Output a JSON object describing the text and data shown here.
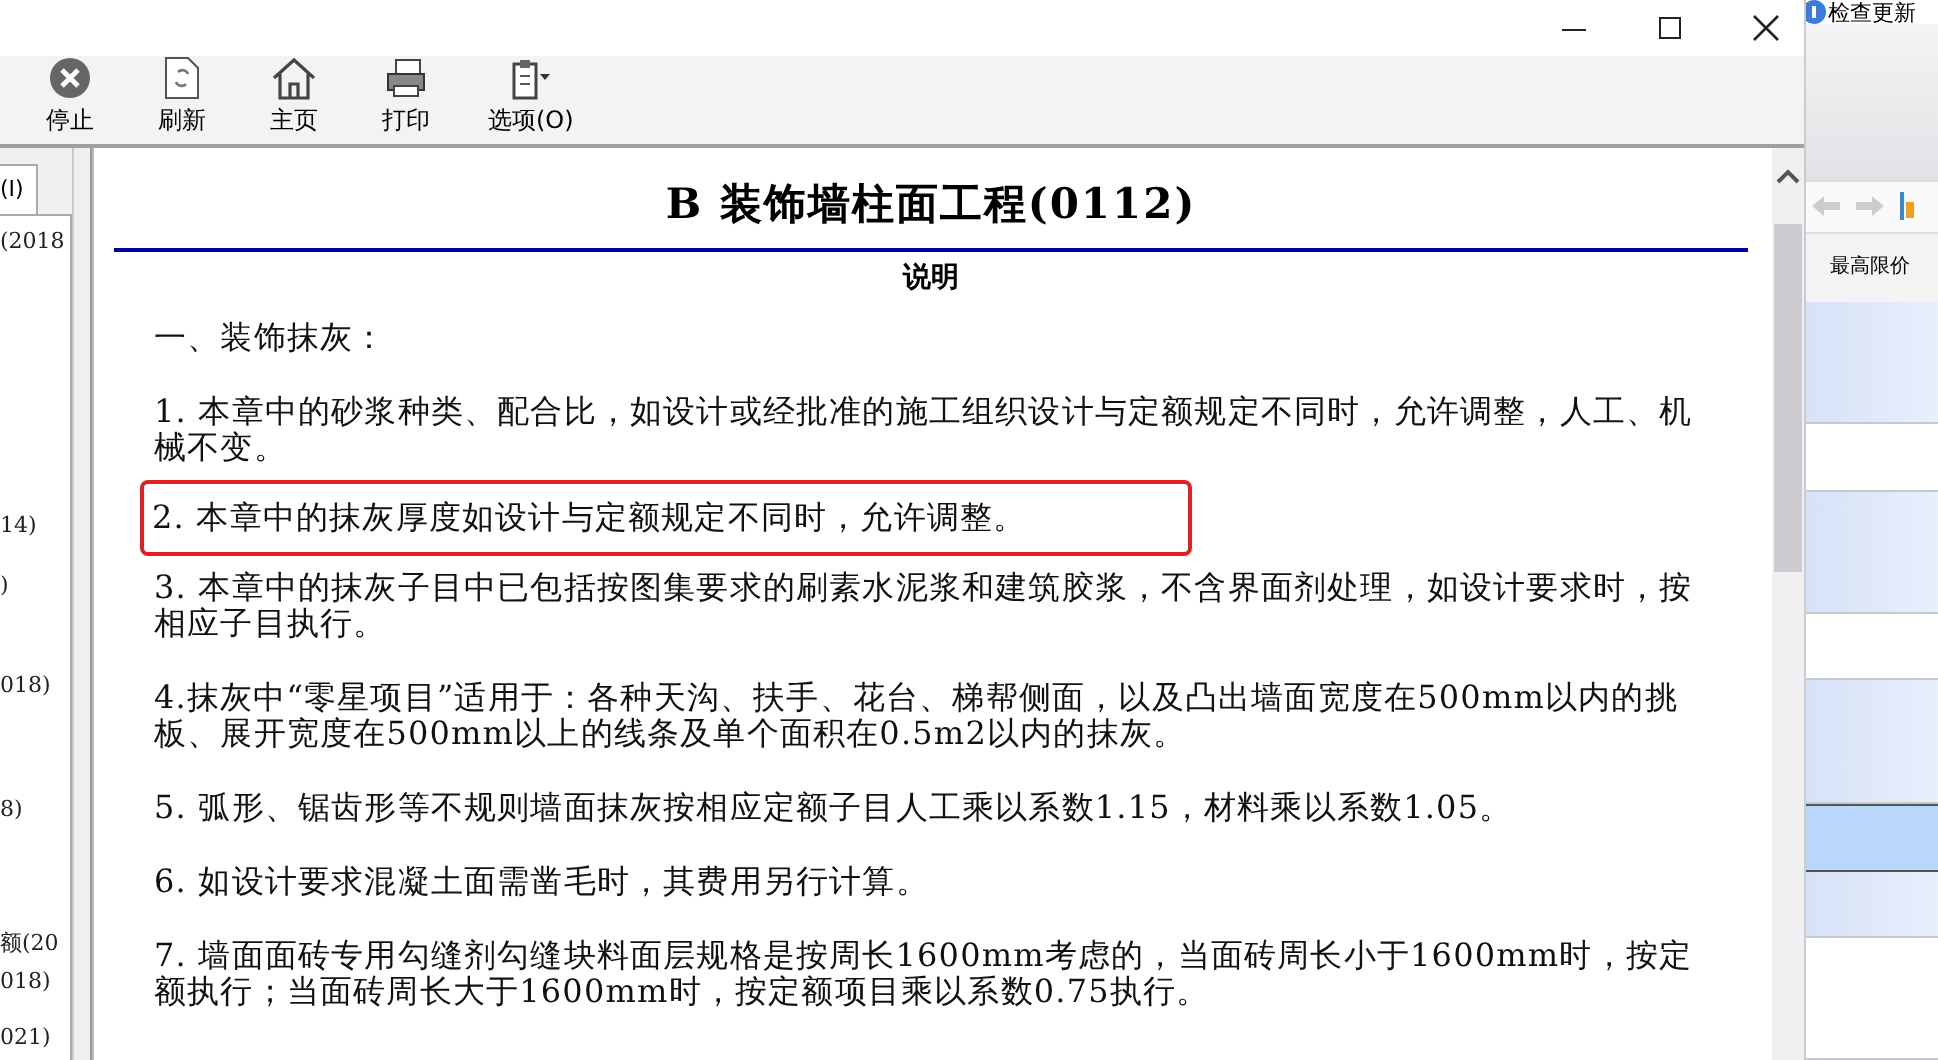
{
  "toolbar": [
    {
      "label": "停止",
      "kind": "stop"
    },
    {
      "label": "刷新",
      "kind": "refresh"
    },
    {
      "label": "主页",
      "kind": "home"
    },
    {
      "label": "打印",
      "kind": "print"
    },
    {
      "label": "选项(O)",
      "kind": "options"
    }
  ],
  "side_pane": {
    "tab": "(I)",
    "items": [
      "(2018",
      "14)",
      ")",
      "018)",
      "8)",
      "额(20",
      "018)",
      "021)"
    ]
  },
  "document": {
    "title": "B 装饰墙柱面工程(0112)",
    "subtitle": "说明",
    "paragraphs": [
      {
        "text": "一、装饰抹灰：",
        "highlighted": false
      },
      {
        "text": "1. 本章中的砂浆种类、配合比，如设计或经批准的施工组织设计与定额规定不同时，允许调整，人工、机械不变。",
        "highlighted": false
      },
      {
        "text": "2. 本章中的抹灰厚度如设计与定额规定不同时，允许调整。",
        "highlighted": true
      },
      {
        "text": "3. 本章中的抹灰子目中已包括按图集要求的刷素水泥浆和建筑胶浆，不含界面剂处理，如设计要求时，按相应子目执行。",
        "highlighted": false
      },
      {
        "text": "4.抹灰中“零星项目”适用于：各种天沟、扶手、花台、梯帮侧面，以及凸出墙面宽度在500mm以内的挑板、展开宽度在500mm以上的线条及单个面积在0.5m2以内的抹灰。",
        "highlighted": false
      },
      {
        "text": "5. 弧形、锯齿形等不规则墙面抹灰按相应定额子目人工乘以系数1.15，材料乘以系数1.05。",
        "highlighted": false
      },
      {
        "text": "6. 如设计要求混凝土面需凿毛时，其费用另行计算。",
        "highlighted": false
      },
      {
        "text": "7. 墙面面砖专用勾缝剂勾缝块料面层规格是按周长1600mm考虑的，当面砖周长小于1600mm时，按定额执行；当面砖周长大于1600mm时，按定额项目乘以系数0.75执行。",
        "highlighted": false
      }
    ]
  },
  "back_app": {
    "update_button": "检查更新",
    "column": "最高限价",
    "rows": [
      {
        "selected": false
      },
      {
        "selected": false
      },
      {
        "selected": false
      },
      {
        "selected": false
      },
      {
        "selected": false
      },
      {
        "selected": true
      },
      {
        "selected": false
      },
      {
        "selected": false
      }
    ]
  }
}
